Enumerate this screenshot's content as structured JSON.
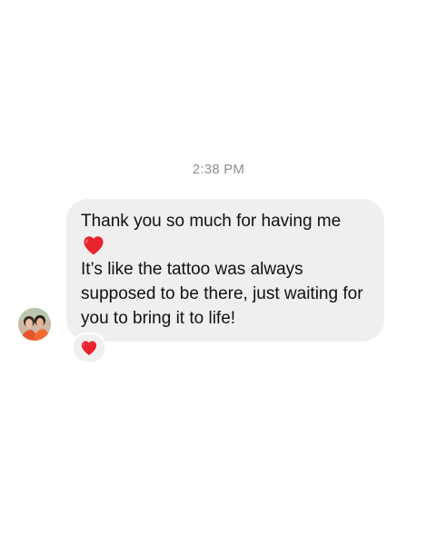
{
  "thread": {
    "timestamp": "2:38 PM",
    "message": {
      "line1": "Thank you so much for having me",
      "heart_icon": "red-heart-emoji",
      "line2": "It’s like the tattoo was always supposed to be there, just waiting for you to bring it to life!",
      "reaction": "red-heart-emoji",
      "bubble_color": "#efefef",
      "heart_color": "#e8242f"
    }
  }
}
